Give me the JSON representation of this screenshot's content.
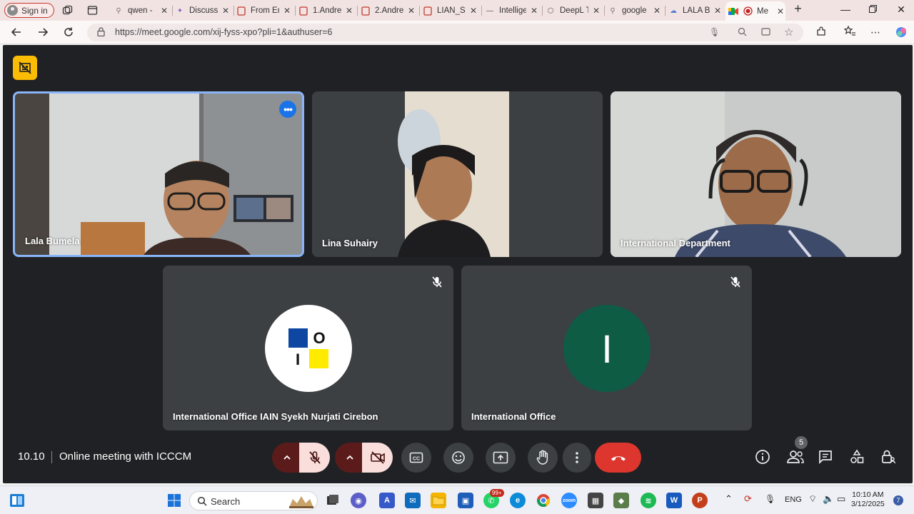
{
  "browser": {
    "signin_label": "Sign in",
    "tabs": [
      {
        "title": "qwen - ",
        "icon": "search-icon"
      },
      {
        "title": "Discussi",
        "icon": "discussion-icon"
      },
      {
        "title": "From En",
        "icon": "pdf-icon"
      },
      {
        "title": "1.Andre",
        "icon": "pdf-icon"
      },
      {
        "title": "2.Andre",
        "icon": "pdf-icon"
      },
      {
        "title": "LIAN_Sy",
        "icon": "pdf-icon"
      },
      {
        "title": "Intellige",
        "icon": "dash-icon"
      },
      {
        "title": "DeepL T",
        "icon": "deepl-icon"
      },
      {
        "title": "google",
        "icon": "search-icon"
      },
      {
        "title": "LALA BU",
        "icon": "cloud-icon"
      },
      {
        "title": "Me",
        "icon": "meet-icon",
        "active": true
      }
    ],
    "url": "https://meet.google.com/xij-fyss-xpo?pli=1&authuser=6"
  },
  "meet": {
    "participants": [
      {
        "name": "Lala Bumela",
        "speaking": true
      },
      {
        "name": "Lina Suhairy"
      },
      {
        "name": "International Department"
      },
      {
        "name": "International Office IAIN Syekh Nurjati Cirebon",
        "muted": true,
        "avatar_text": [
          "O",
          "I"
        ]
      },
      {
        "name": "International Office",
        "muted": true,
        "avatar_letter": "I",
        "avatar_color": "#0e5c44"
      }
    ],
    "meeting_time": "10.10",
    "meeting_title": "Online meeting with ICCCM",
    "participant_count": "5",
    "colors": {
      "end_call": "#dc362e",
      "mic_off_bg": "#f9dedc",
      "speaker_border": "#8ab4f8"
    }
  },
  "taskbar": {
    "search_label": "Search",
    "whatsapp_badge": "99+",
    "language": "ENG",
    "time": "10:10 AM",
    "date": "3/12/2025",
    "notifications": "7"
  }
}
